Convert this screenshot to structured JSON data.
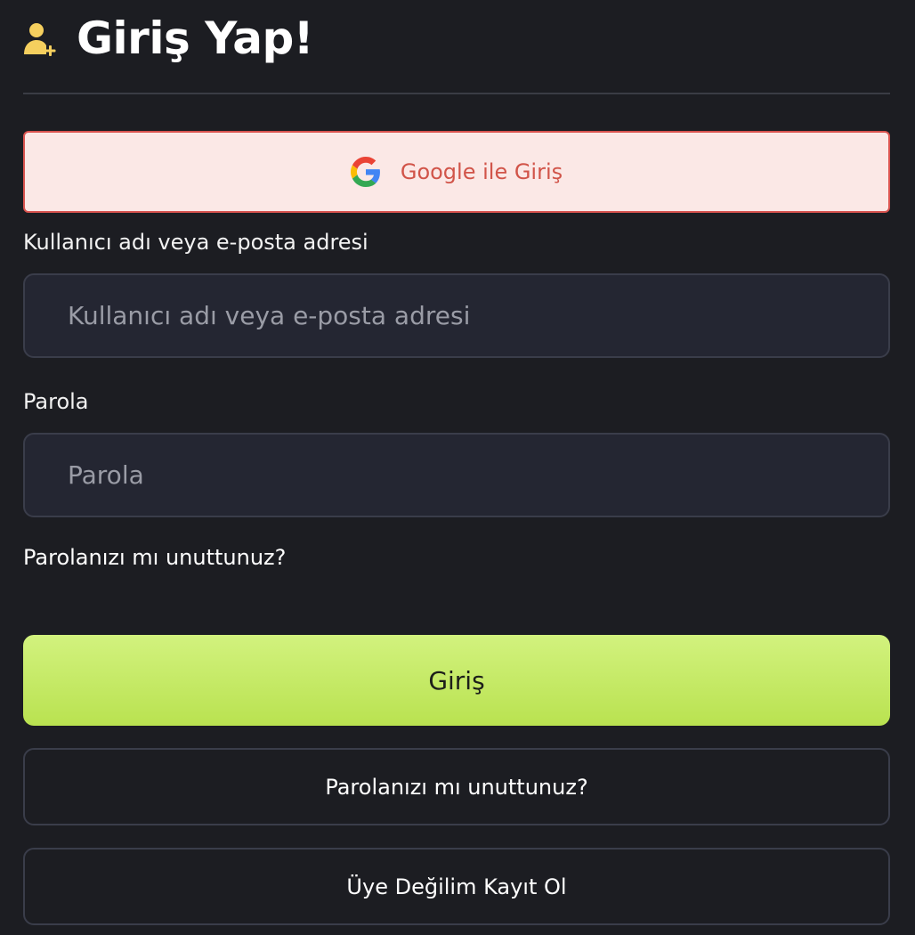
{
  "header": {
    "title": "Giriş Yap!",
    "icon": "user-plus-icon",
    "icon_color": "#f5cf5e"
  },
  "google_button": {
    "label": "Google ile Giriş",
    "icon": "google-icon",
    "bg_color": "#fbe8e6",
    "text_color": "#d15449"
  },
  "username": {
    "label": "Kullanıcı adı veya e-posta adresi",
    "placeholder": "Kullanıcı adı veya e-posta adresi",
    "value": ""
  },
  "password": {
    "label": "Parola",
    "placeholder": "Parola",
    "value": ""
  },
  "forgot_link": "Parolanızı mı unuttunuz?",
  "login_button": {
    "label": "Giriş",
    "color": "#c6ea64"
  },
  "forgot_button": "Parolanızı mı unuttunuz?",
  "register_button": "Üye Değilim Kayıt Ol"
}
